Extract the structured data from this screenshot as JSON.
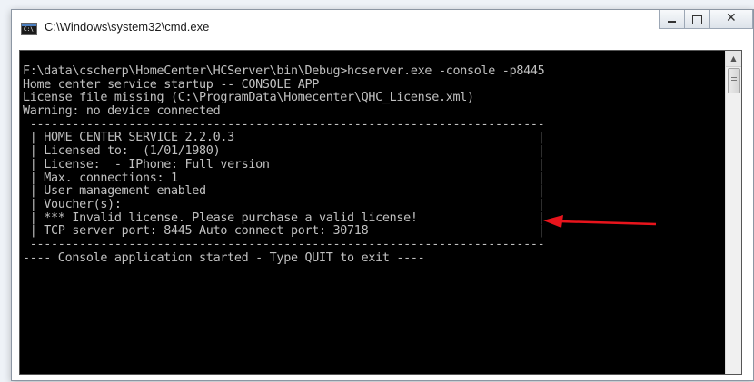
{
  "window": {
    "title": "C:\\Windows\\system32\\cmd.exe",
    "icon": "cmd-icon",
    "icon_text": "C:\\"
  },
  "controls": {
    "minimize": "minimize-icon",
    "maximize": "maximize-icon",
    "close": "close-icon",
    "close_glyph": "✕"
  },
  "console": {
    "lines": [
      "F:\\data\\cscherp\\HomeCenter\\HCServer\\bin\\Debug>hcserver.exe -console -p8445",
      "Home center service startup -- CONSOLE APP",
      "License file missing (C:\\ProgramData\\Homecenter\\QHC_License.xml)",
      "Warning: no device connected",
      " -------------------------------------------------------------------------",
      " | HOME CENTER SERVICE 2.2.0.3                                           |",
      " | Licensed to:  (1/01/1980)                                             |",
      " | License:  - IPhone: Full version                                      |",
      " | Max. connections: 1                                                   |",
      " | User management enabled                                               |",
      " | Voucher(s):                                                           |",
      " | *** Invalid license. Please purchase a valid license!                 |",
      " | TCP server port: 8445 Auto connect port: 30718                        |",
      " -------------------------------------------------------------------------",
      "---- Console application started - Type QUIT to exit ----"
    ]
  },
  "scrollbar": {
    "up_glyph": "▲"
  },
  "annotation": {
    "arrow_color": "#e8141c"
  }
}
